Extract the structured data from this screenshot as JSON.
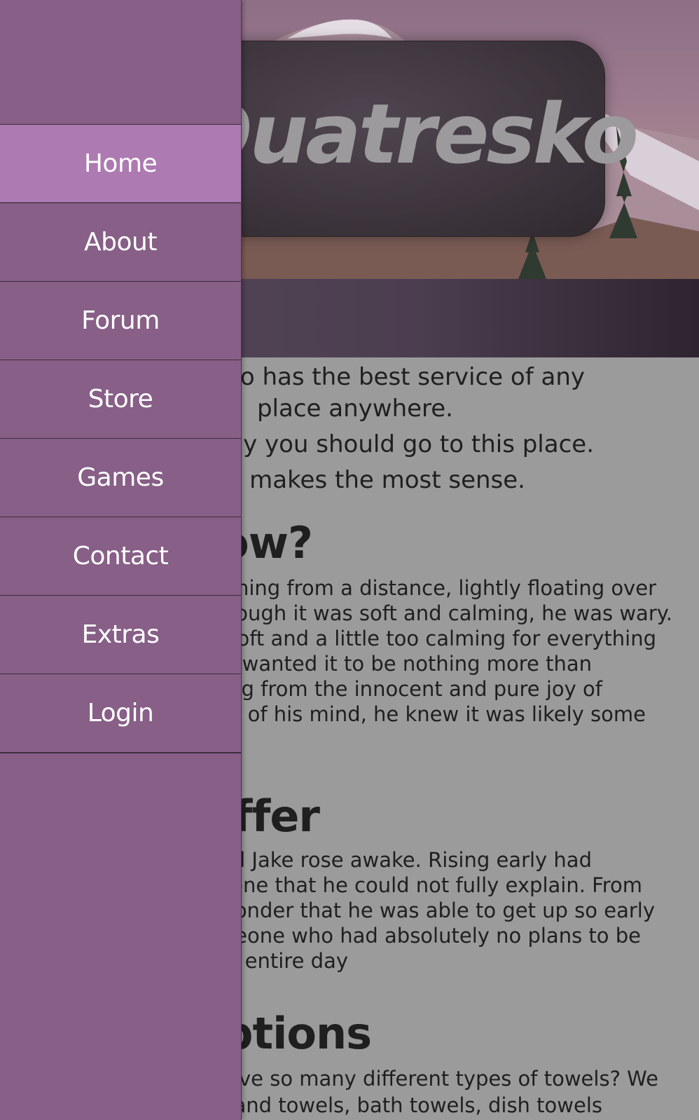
{
  "header": {
    "site_title": "Quatresko"
  },
  "content": {
    "lead_lines": [
      "Quatresko has the best service of any",
      "place anywhere.",
      "This is why you should go to this place.",
      "It makes the most sense."
    ],
    "sections": [
      {
        "heading": "Know?",
        "lines": [
          "He could hear it coming from a distance, lightly floating over",
          "the hills. Even though it was soft and calming, he was wary.",
          "It was a little too soft and a little too calming for everything",
          "to be right. He wanted it to be nothing more than",
          "the laughter coming from the innocent and pure joy of",
          "but in the back of his mind, he knew it was likely some",
          ""
        ]
      },
      {
        "heading": "We Offer",
        "lines": [
          "The alarm sounded Jake rose awake. Rising early had",
          "become a habit, one that he could not fully explain. From",
          "others it was a wonder that he was able to get up so early",
          "for someone, someone who had absolutely no plans to be",
          "productive the entire day"
        ]
      },
      {
        "heading": "Towel Options",
        "lines": [
          "Why would you have so many different types of towels? We",
          "have hand towels, bath towels, dish towels"
        ]
      }
    ]
  },
  "nav": {
    "items": [
      {
        "label": "Home",
        "active": true
      },
      {
        "label": "About",
        "active": false
      },
      {
        "label": "Forum",
        "active": false
      },
      {
        "label": "Store",
        "active": false
      },
      {
        "label": "Games",
        "active": false
      },
      {
        "label": "Contact",
        "active": false
      },
      {
        "label": "Extras",
        "active": false
      },
      {
        "label": "Login",
        "active": false
      }
    ]
  },
  "colors": {
    "sidebar": "#875f87",
    "sidebar_active": "#ad7ab2",
    "content_bg": "#9b9b9b",
    "title_box": "#3a3239"
  }
}
